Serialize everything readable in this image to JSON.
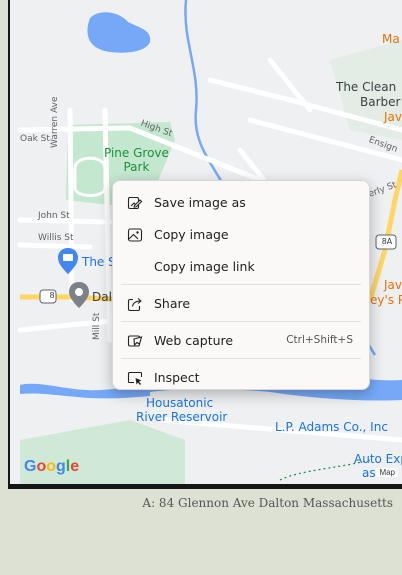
{
  "map": {
    "labels": {
      "pine_grove_park": "Pine Grove\nPark",
      "oak_st": "Oak St",
      "warren_ave": "Warren Ave",
      "high_st": "High St",
      "john_st": "John St",
      "willis_st": "Willis St",
      "mill_st": "Mill St",
      "ensign": "Ensign",
      "route_8": "8",
      "route_8a": "8A",
      "the_clean": "The Clean",
      "barber": "Barber",
      "java_1": "Java",
      "java_2": "ey's P",
      "the_s": "The S",
      "dal": "Dal",
      "ma": "Ma",
      "housatonic_1": "Housatonic",
      "housatonic_2": "River Reservoir",
      "lp_adams": "L.P. Adams Co., Inc",
      "auto_exp_1": "Auto Exp",
      "auto_exp_2": "as",
      "erly_st": "erly St",
      "google": "Google",
      "map_data": "Map"
    }
  },
  "context_menu": {
    "items": [
      {
        "label": "Save image as",
        "icon": "save-image-icon"
      },
      {
        "label": "Copy image",
        "icon": "image-icon"
      },
      {
        "label": "Copy image link",
        "icon": ""
      },
      {
        "label": "Share",
        "icon": "share-icon"
      },
      {
        "label": "Web capture",
        "icon": "web-capture-icon",
        "shortcut": "Ctrl+Shift+S"
      },
      {
        "label": "Inspect",
        "icon": "inspect-icon"
      }
    ]
  },
  "caption": "A: 84 Glennon Ave Dalton Massachusetts",
  "colors": {
    "map_bg": "#eef0f2",
    "water": "#75a9f8",
    "park": "#c4e7cf",
    "road_yellow": "#fdd663",
    "road_white": "#ffffff",
    "page_bg": "#dde1d3",
    "menu_bg": "#fbf9f8"
  }
}
